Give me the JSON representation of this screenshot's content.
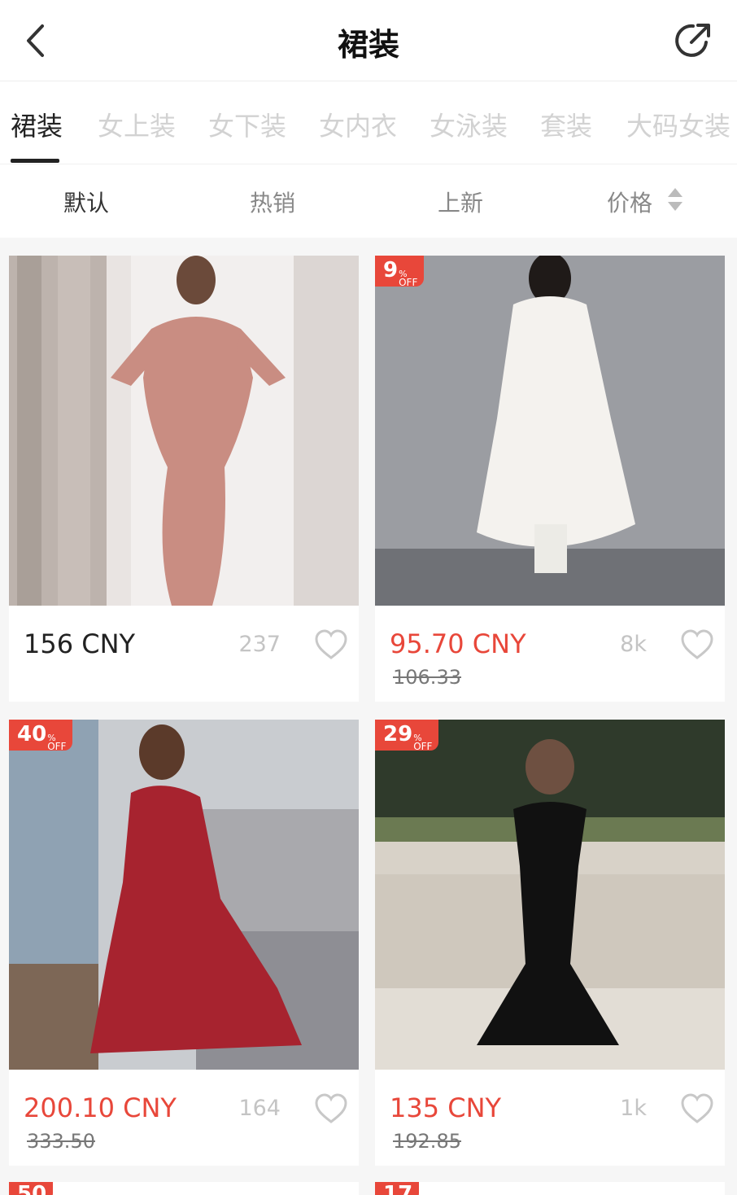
{
  "header": {
    "title": "裙装"
  },
  "tabs": [
    "裙装",
    "女上装",
    "女下装",
    "女内衣",
    "女泳装",
    "套装",
    "大码女装"
  ],
  "sort": [
    "默认",
    "热销",
    "上新",
    "价格"
  ],
  "products": [
    {
      "price": "156 CNY",
      "orig": "",
      "likes": "237",
      "badge_num": "",
      "badge_pct": "",
      "badge_off": ""
    },
    {
      "price": "95.70 CNY",
      "orig": "106.33",
      "likes": "8k",
      "badge_num": "9",
      "badge_pct": "%",
      "badge_off": "OFF"
    },
    {
      "price": "200.10 CNY",
      "orig": "333.50",
      "likes": "164",
      "badge_num": "40",
      "badge_pct": "%",
      "badge_off": "OFF"
    },
    {
      "price": "135 CNY",
      "orig": "192.85",
      "likes": "1k",
      "badge_num": "29",
      "badge_pct": "%",
      "badge_off": "OFF"
    }
  ],
  "peek_badges": [
    {
      "num": "50"
    },
    {
      "num": "17"
    }
  ],
  "colors": {
    "accent": "#e8473a",
    "text": "#222222",
    "muted": "#c4c4c4"
  }
}
